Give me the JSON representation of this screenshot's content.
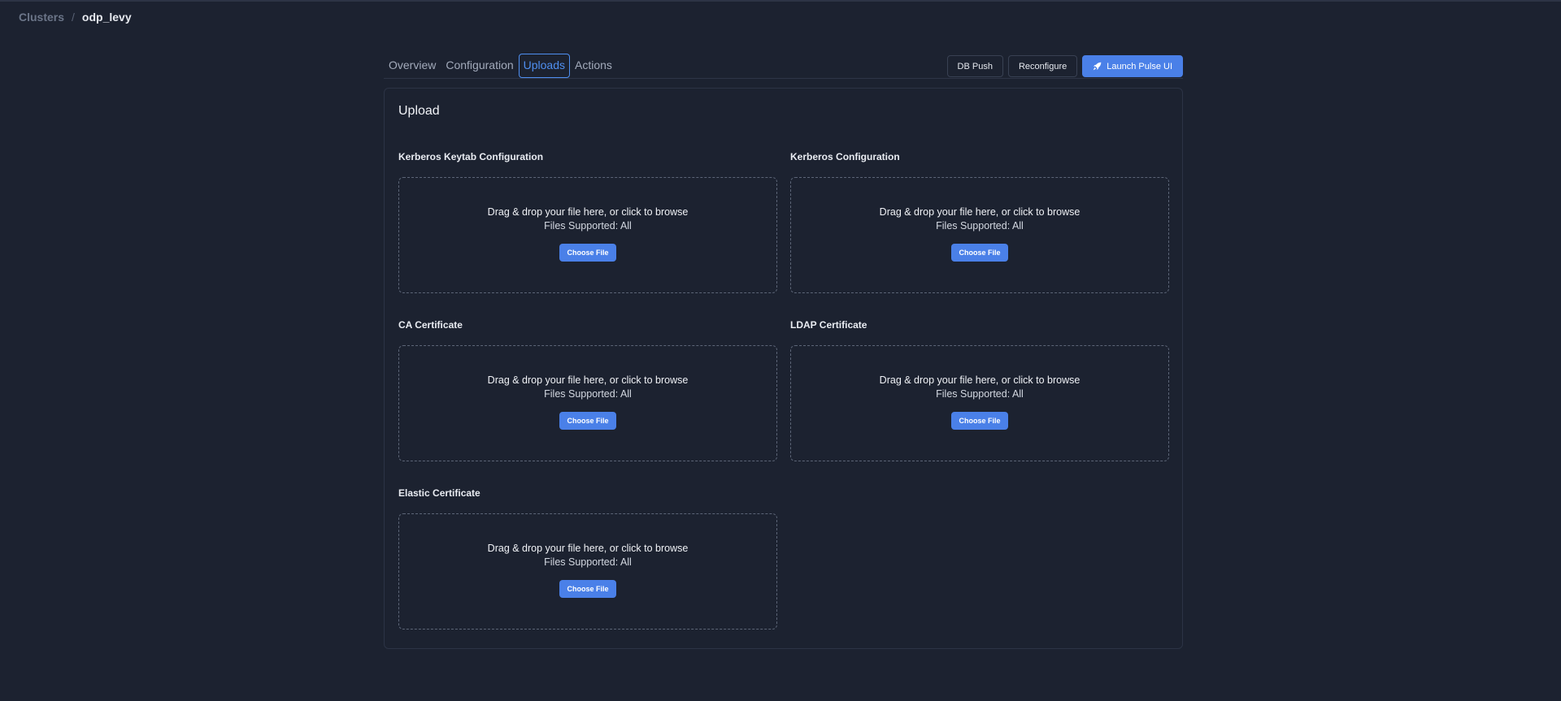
{
  "breadcrumb": {
    "parent": "Clusters",
    "separator": "/",
    "current": "odp_levy"
  },
  "tabs": [
    {
      "label": "Overview"
    },
    {
      "label": "Configuration"
    },
    {
      "label": "Uploads",
      "active": true
    },
    {
      "label": "Actions"
    }
  ],
  "header_actions": {
    "db_push": "DB Push",
    "reconfigure": "Reconfigure",
    "launch_pulse": "Launch Pulse UI",
    "launch_icon": "rocket-icon"
  },
  "upload": {
    "title": "Upload",
    "sections": [
      {
        "label": "Kerberos Keytab Configuration",
        "drop_text": "Drag & drop your file here, or click to browse",
        "supported": "Files Supported: All",
        "button": "Choose File"
      },
      {
        "label": "Kerberos Configuration",
        "drop_text": "Drag & drop your file here, or click to browse",
        "supported": "Files Supported: All",
        "button": "Choose File"
      },
      {
        "label": "CA Certificate",
        "drop_text": "Drag & drop your file here, or click to browse",
        "supported": "Files Supported: All",
        "button": "Choose File"
      },
      {
        "label": "LDAP Certificate",
        "drop_text": "Drag & drop your file here, or click to browse",
        "supported": "Files Supported: All",
        "button": "Choose File"
      },
      {
        "label": "Elastic Certificate",
        "drop_text": "Drag & drop your file here, or click to browse",
        "supported": "Files Supported: All",
        "button": "Choose File"
      }
    ]
  },
  "colors": {
    "background": "#1c2230",
    "accent": "#4a80e8",
    "active_tab": "#4f8ff0",
    "muted_text": "#6b7588"
  }
}
